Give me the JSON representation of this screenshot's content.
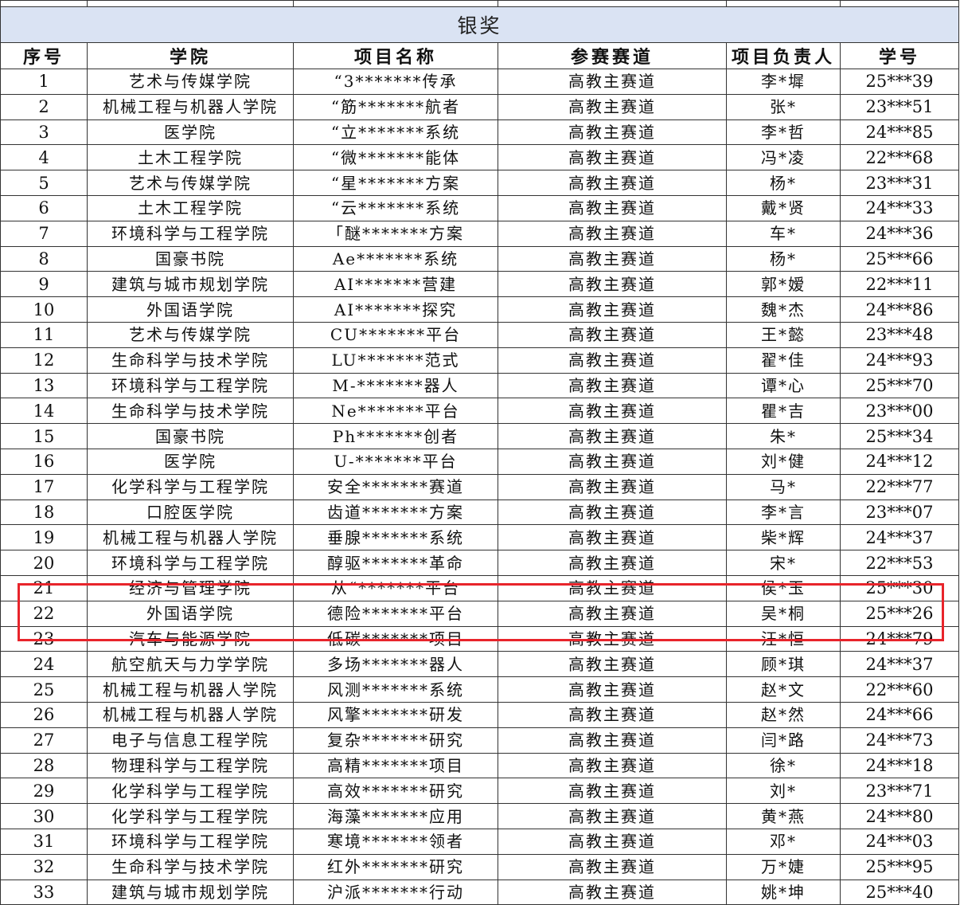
{
  "section_title": "银奖",
  "headers": [
    "序号",
    "学院",
    "项目名称",
    "参赛赛道",
    "项目负责人",
    "学号"
  ],
  "rows": [
    [
      "1",
      "艺术与传媒学院",
      "“3*******传承",
      "高教主赛道",
      "李*墀",
      "25***39"
    ],
    [
      "2",
      "机械工程与机器人学院",
      "“筋*******航者",
      "高教主赛道",
      "张*",
      "23***51"
    ],
    [
      "3",
      "医学院",
      "“立*******系统",
      "高教主赛道",
      "李*哲",
      "24***85"
    ],
    [
      "4",
      "土木工程学院",
      "“微*******能体",
      "高教主赛道",
      "冯*凌",
      "22***68"
    ],
    [
      "5",
      "艺术与传媒学院",
      "“星*******方案",
      "高教主赛道",
      "杨*",
      "23***31"
    ],
    [
      "6",
      "土木工程学院",
      "“云*******系统",
      "高教主赛道",
      "戴*贤",
      "24***33"
    ],
    [
      "7",
      "环境科学与工程学院",
      "「醚*******方案",
      "高教主赛道",
      "车*",
      "24***36"
    ],
    [
      "8",
      "国豪书院",
      "Ae*******系统",
      "高教主赛道",
      "杨*",
      "25***66"
    ],
    [
      "9",
      "建筑与城市规划学院",
      "AI*******营建",
      "高教主赛道",
      "郭*嫒",
      "22***11"
    ],
    [
      "10",
      "外国语学院",
      "AI*******探究",
      "高教主赛道",
      "魏*杰",
      "24***86"
    ],
    [
      "11",
      "艺术与传媒学院",
      "CU*******平台",
      "高教主赛道",
      "王*懿",
      "23***48"
    ],
    [
      "12",
      "生命科学与技术学院",
      "LU*******范式",
      "高教主赛道",
      "翟*佳",
      "24***93"
    ],
    [
      "13",
      "环境科学与工程学院",
      "M-*******器人",
      "高教主赛道",
      "谭*心",
      "25***70"
    ],
    [
      "14",
      "生命科学与技术学院",
      "Ne*******平台",
      "高教主赛道",
      "瞿*吉",
      "23***00"
    ],
    [
      "15",
      "国豪书院",
      "Ph*******创者",
      "高教主赛道",
      "朱*",
      "25***34"
    ],
    [
      "16",
      "医学院",
      "U-*******平台",
      "高教主赛道",
      "刘*健",
      "24***12"
    ],
    [
      "17",
      "化学科学与工程学院",
      "安全*******赛道",
      "高教主赛道",
      "马*",
      "22***77"
    ],
    [
      "18",
      "口腔医学院",
      "齿道*******方案",
      "高教主赛道",
      "李*言",
      "23***07"
    ],
    [
      "19",
      "机械工程与机器人学院",
      "垂腺*******系统",
      "高教主赛道",
      "柴*辉",
      "24***37"
    ],
    [
      "20",
      "环境科学与工程学院",
      "醇驱*******革命",
      "高教主赛道",
      "宋*",
      "22***53"
    ],
    [
      "21",
      "经济与管理学院",
      "从“*******平台",
      "高教主赛道",
      "侯*玉",
      "25***30"
    ],
    [
      "22",
      "外国语学院",
      "德险*******平台",
      "高教主赛道",
      "吴*桐",
      "25***26"
    ],
    [
      "23",
      "汽车与能源学院",
      "低碳*******项目",
      "高教主赛道",
      "汪*恒",
      "24***79"
    ],
    [
      "24",
      "航空航天与力学学院",
      "多场*******器人",
      "高教主赛道",
      "顾*琪",
      "24***37"
    ],
    [
      "25",
      "机械工程与机器人学院",
      "风测*******系统",
      "高教主赛道",
      "赵*文",
      "22***60"
    ],
    [
      "26",
      "机械工程与机器人学院",
      "风擎*******研发",
      "高教主赛道",
      "赵*然",
      "24***66"
    ],
    [
      "27",
      "电子与信息工程学院",
      "复杂*******研究",
      "高教主赛道",
      "闫*路",
      "24***73"
    ],
    [
      "28",
      "物理科学与工程学院",
      "高精*******项目",
      "高教主赛道",
      "徐*",
      "24***18"
    ],
    [
      "29",
      "化学科学与工程学院",
      "高效*******研究",
      "高教主赛道",
      "刘*",
      "23***71"
    ],
    [
      "30",
      "化学科学与工程学院",
      "海藻*******应用",
      "高教主赛道",
      "黄*燕",
      "24***80"
    ],
    [
      "31",
      "环境科学与工程学院",
      "寒境*******领者",
      "高教主赛道",
      "邓*",
      "24***03"
    ],
    [
      "32",
      "生命科学与技术学院",
      "红外*******研究",
      "高教主赛道",
      "万*婕",
      "25***95"
    ],
    [
      "33",
      "建筑与城市规划学院",
      "沪派*******行动",
      "高教主赛道",
      "姚*坤",
      "25***40"
    ]
  ],
  "highlight_color": "#e8242b",
  "banner_color": "#dae3f3"
}
